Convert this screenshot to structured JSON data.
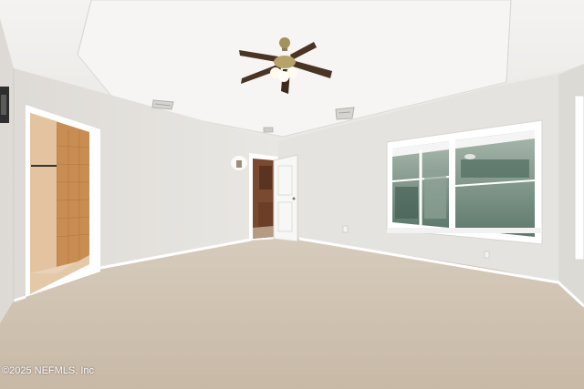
{
  "photo": {
    "watermark": "©2025 NEFMLS, Inc",
    "colors": {
      "ceiling": "#f2f1ef",
      "wall": "#e6e4e0",
      "carpet": "#cfc2b1",
      "baseboard": "#ffffff",
      "fan_blade": "#4a3424",
      "bathroom_tile": "#c88d52",
      "window_view": "#5f7a6f"
    }
  }
}
